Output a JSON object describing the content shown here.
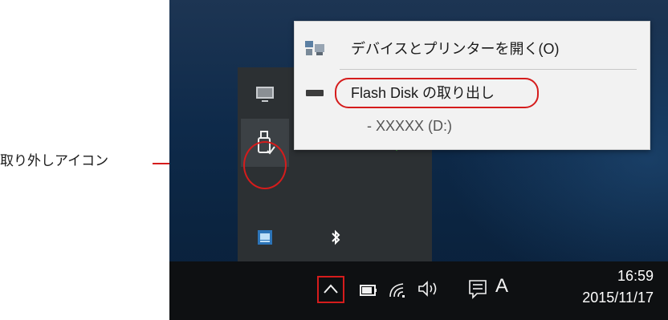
{
  "callout": {
    "label": "取り外しアイコン"
  },
  "context_menu": {
    "items": [
      {
        "label": "デバイスとプリンターを開く(O)",
        "icon": "devices-printers-icon"
      },
      {
        "label": "Flash Disk の取り出し",
        "icon": "usb-drive-icon"
      },
      {
        "label": "- XXXXX (D:)",
        "icon": ""
      }
    ]
  },
  "tray_overflow": {
    "icons": [
      "display-icon",
      "usb-eject-icon",
      "speaker-icon",
      "network-check-icon",
      "window-app-icon",
      "bluetooth-icon"
    ]
  },
  "taskbar": {
    "icons": [
      "show-hidden-icons-chevron-icon",
      "battery-icon",
      "wifi-icon",
      "volume-icon",
      "action-center-icon"
    ],
    "ime_label": "A",
    "clock": {
      "time": "16:59",
      "date": "2015/11/17"
    }
  },
  "colors": {
    "highlight_red": "#d51c1c",
    "taskbar": "#0e1012",
    "flyout": "#2c3033",
    "menu_bg": "#f2f2f2"
  }
}
